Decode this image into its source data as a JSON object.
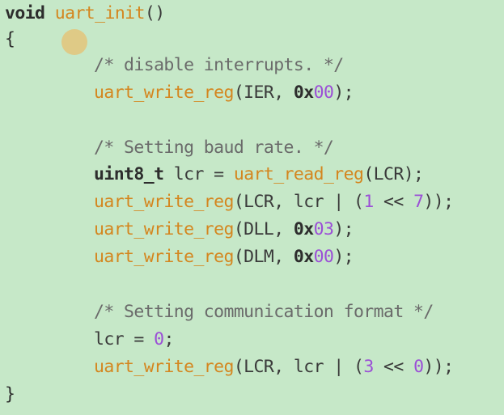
{
  "colors": {
    "background": "#c6e8c8",
    "function": "#d4861f",
    "number": "#9b4fd6",
    "comment": "#6a6a6a",
    "keyword": "#2d2d2d",
    "cursor": "#e3c47a"
  },
  "cursor_icon": "cursor-highlight-dot",
  "code": {
    "l1": {
      "kw": "void",
      "fn": "uart_init",
      "rest": "()"
    },
    "l2": {
      "brace": "{"
    },
    "l3": {
      "comment": "/* disable interrupts. */"
    },
    "l4": {
      "fn": "uart_write_reg",
      "a": "(IER, ",
      "p": "0x",
      "n": "00",
      "b": ");"
    },
    "l6": {
      "comment": "/* Setting baud rate. */"
    },
    "l7": {
      "kw": "uint8_t",
      "a": " lcr = ",
      "fn": "uart_read_reg",
      "b": "(LCR);"
    },
    "l8": {
      "fn": "uart_write_reg",
      "a": "(LCR, lcr | (",
      "n1": "1",
      "op": " << ",
      "n2": "7",
      "b": "));"
    },
    "l9": {
      "fn": "uart_write_reg",
      "a": "(DLL, ",
      "p": "0x",
      "n": "03",
      "b": ");"
    },
    "l10": {
      "fn": "uart_write_reg",
      "a": "(DLM, ",
      "p": "0x",
      "n": "00",
      "b": ");"
    },
    "l12": {
      "comment": "/* Setting communication format */"
    },
    "l13": {
      "a": "lcr = ",
      "n": "0",
      "b": ";"
    },
    "l14": {
      "fn": "uart_write_reg",
      "a": "(LCR, lcr | (",
      "n1": "3",
      "op": " << ",
      "n2": "0",
      "b": "));"
    },
    "l15": {
      "brace": "}"
    }
  }
}
